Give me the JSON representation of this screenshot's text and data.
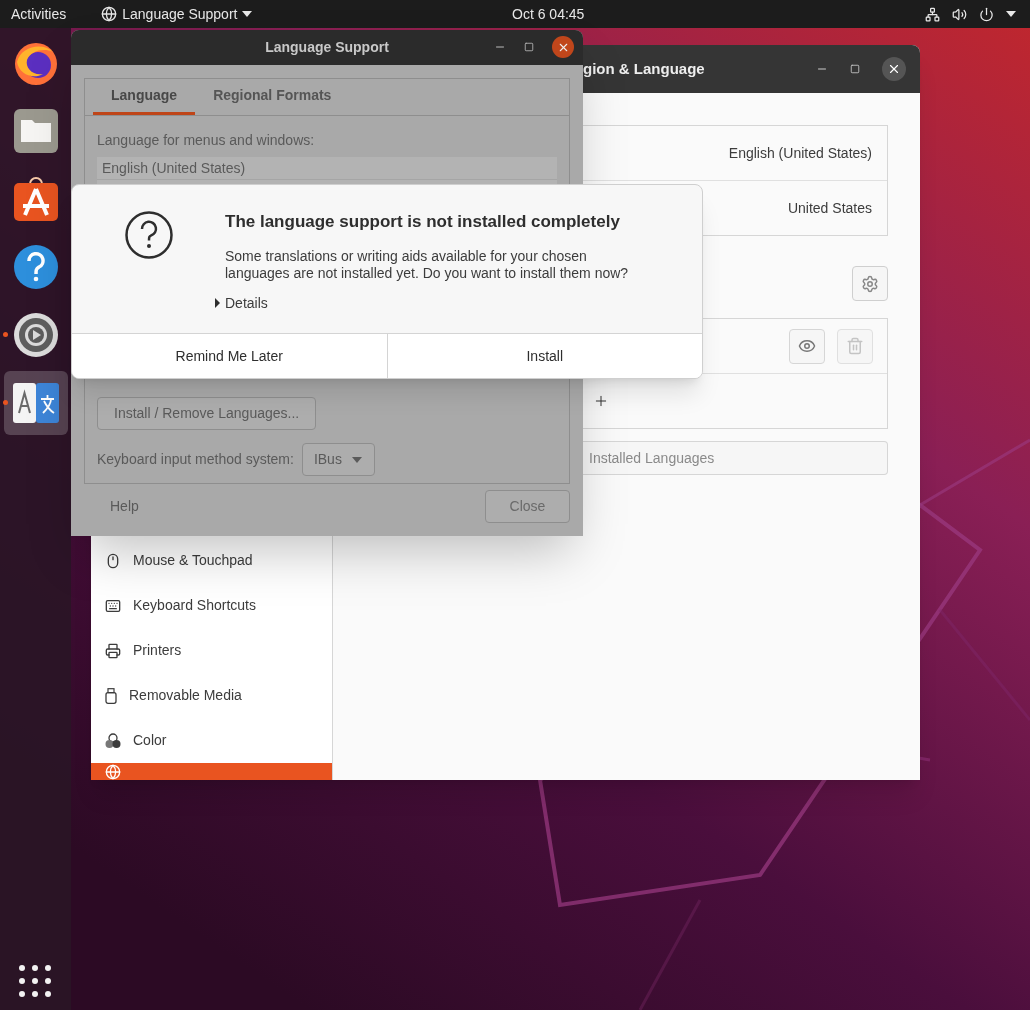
{
  "top_bar": {
    "activities": "Activities",
    "app_menu": "Language Support",
    "clock": "Oct 6  04:45"
  },
  "dock": [
    {
      "kind": "browser",
      "running": false,
      "active": false
    },
    {
      "kind": "files",
      "running": false,
      "active": false
    },
    {
      "kind": "store",
      "running": false,
      "active": false
    },
    {
      "kind": "help",
      "running": false,
      "active": false
    },
    {
      "kind": "settings",
      "running": true,
      "active": false
    },
    {
      "kind": "language",
      "running": true,
      "active": true
    }
  ],
  "settings_window": {
    "title": "gion & Language",
    "sidebar": [
      {
        "kind": "mouse",
        "label": "Mouse & Touchpad",
        "selected": false
      },
      {
        "kind": "keyboard",
        "label": "Keyboard Shortcuts",
        "selected": false
      },
      {
        "kind": "printer",
        "label": "Printers",
        "selected": false
      },
      {
        "kind": "media",
        "label": "Removable Media",
        "selected": false
      },
      {
        "kind": "color",
        "label": "Color",
        "selected": false
      },
      {
        "kind": "region",
        "selected": true
      }
    ],
    "language_value": "English (United States)",
    "formats_value": "United States",
    "manage_button": "Installed Languages"
  },
  "language_support_window": {
    "title": "Language Support",
    "tabs": [
      {
        "label": "Language",
        "selected": true
      },
      {
        "label": "Regional Formats",
        "selected": false
      }
    ],
    "list_label": "Language for menus and windows:",
    "languages": [
      "English (United States)"
    ],
    "install_button": "Install / Remove Languages...",
    "keyboard_label": "Keyboard input method system:",
    "keyboard_method": "IBus",
    "help_button": "Help",
    "close_button": "Close"
  },
  "dialog": {
    "title": "The language support is not installed completely",
    "message": "Some translations or writing aids available for your chosen languages are not installed yet. Do you want to install them now?",
    "details": {
      "label": "Details",
      "expanded": false
    },
    "buttons": [
      "Remind Me Later",
      "Install"
    ]
  }
}
